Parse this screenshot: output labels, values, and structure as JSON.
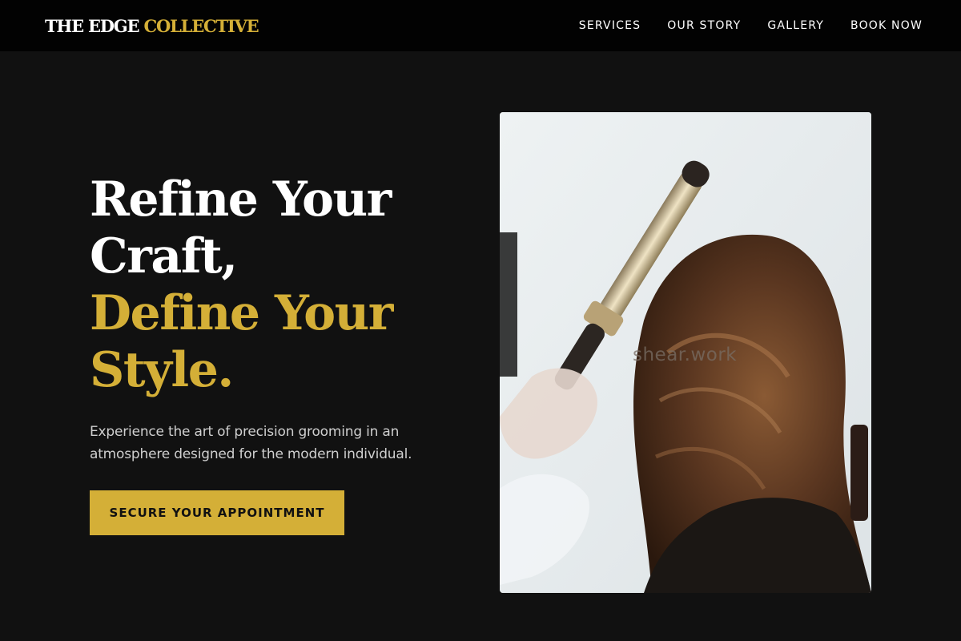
{
  "brand": {
    "part1": "THE EDGE",
    "part2": "COLLECTIVE"
  },
  "nav": {
    "items": [
      "SERVICES",
      "OUR STORY",
      "GALLERY",
      "BOOK NOW"
    ]
  },
  "hero": {
    "line1": "Refine Your",
    "line2": "Craft,",
    "line3": "Define Your",
    "line4": "Style.",
    "subtitle": "Experience the art of precision grooming in an atmosphere designed for the modern individual.",
    "cta": "SECURE YOUR APPOINTMENT",
    "image_watermark": "shear.work"
  },
  "colors": {
    "accent": "#d4af37",
    "background": "#111111",
    "nav_bg": "#020202"
  }
}
